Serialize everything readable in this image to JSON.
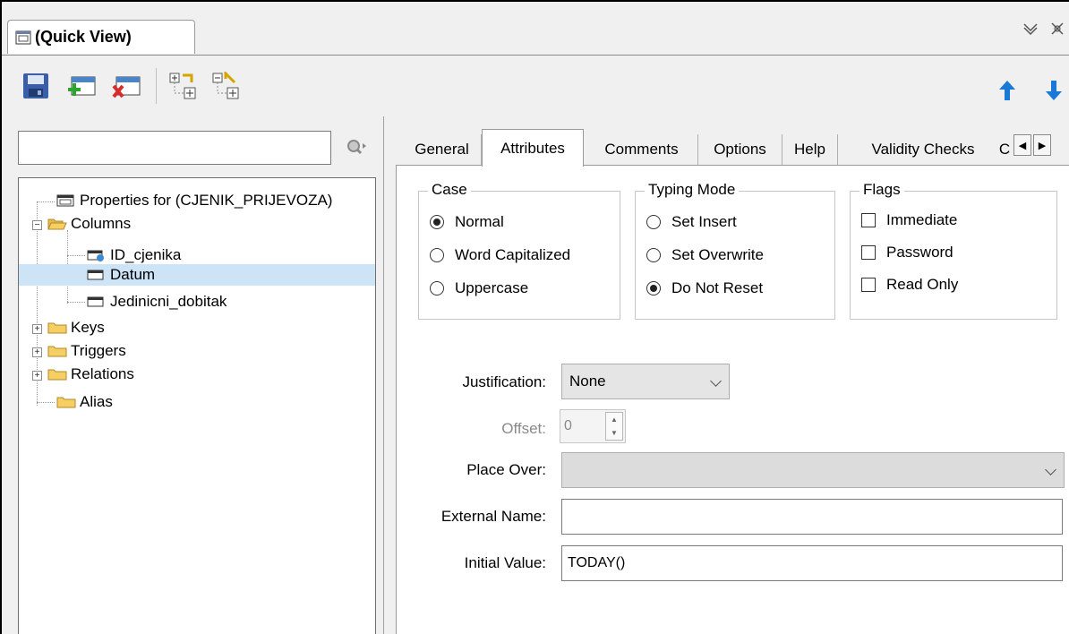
{
  "window": {
    "title": "(Quick View)",
    "controls": [
      "chevron-down-icon",
      "pin-icon"
    ]
  },
  "toolbar": {
    "buttons": [
      "save-icon",
      "add-column-icon",
      "delete-column-icon",
      "expand-all-icon",
      "collapse-all-icon"
    ],
    "nav": [
      "move-up-icon",
      "move-down-icon"
    ]
  },
  "search": {
    "value": ""
  },
  "tree": {
    "items": [
      {
        "label": "Properties for (CJENIK_PRIJEVOZA)",
        "icon": "table-icon"
      },
      {
        "label": "Columns",
        "icon": "folder-open-icon",
        "expanded": true
      },
      {
        "label": "ID_cjenika",
        "icon": "key-column-icon"
      },
      {
        "label": "Datum",
        "icon": "column-icon",
        "selected": true
      },
      {
        "label": "Jedinicni_dobitak",
        "icon": "column-icon"
      },
      {
        "label": "Keys",
        "icon": "folder-icon"
      },
      {
        "label": "Triggers",
        "icon": "folder-icon"
      },
      {
        "label": "Relations",
        "icon": "folder-icon"
      },
      {
        "label": "Alias",
        "icon": "folder-icon"
      }
    ]
  },
  "tabs": {
    "items": [
      "General",
      "Attributes",
      "Comments",
      "Options",
      "Help",
      "Validity Checks",
      "C"
    ],
    "active": "Attributes"
  },
  "attributes": {
    "case": {
      "label": "Case",
      "options": [
        "Normal",
        "Word Capitalized",
        "Uppercase"
      ],
      "selected": "Normal"
    },
    "typing_mode": {
      "label": "Typing Mode",
      "options": [
        "Set Insert",
        "Set Overwrite",
        "Do Not Reset"
      ],
      "selected": "Do Not Reset"
    },
    "flags": {
      "label": "Flags",
      "options": [
        "Immediate",
        "Password",
        "Read Only"
      ],
      "checked": []
    },
    "justification": {
      "label": "Justification:",
      "value": "None"
    },
    "offset": {
      "label": "Offset:",
      "value": "0",
      "disabled": true
    },
    "place_over": {
      "label": "Place Over:",
      "value": ""
    },
    "external_name": {
      "label": "External Name:",
      "value": ""
    },
    "initial_value": {
      "label": "Initial Value:",
      "value": "TODAY()"
    }
  },
  "colors": {
    "selection": "#cde4f7",
    "arrow_blue": "#1a78d6",
    "folder_yellow": "#f5cf63"
  }
}
